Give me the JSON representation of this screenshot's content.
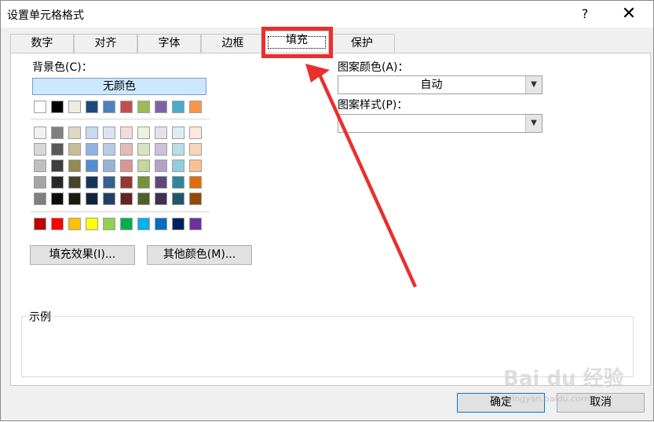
{
  "window": {
    "title": "设置单元格格式",
    "help": "?",
    "close": "✕"
  },
  "tabs": [
    {
      "label": "数字"
    },
    {
      "label": "对齐"
    },
    {
      "label": "字体"
    },
    {
      "label": "边框"
    },
    {
      "label": "填充",
      "active": true
    },
    {
      "label": "保护"
    }
  ],
  "fill": {
    "background_label": "背景色(C)：",
    "no_color": "无颜色",
    "theme_row": [
      "#ffffff",
      "#000000",
      "#eeece1",
      "#1f497d",
      "#4f81bd",
      "#c0504d",
      "#9bbb59",
      "#8064a2",
      "#4bacc6",
      "#f79646"
    ],
    "tint_rows": [
      [
        "#f2f2f2",
        "#7f7f7f",
        "#ddd9c3",
        "#c6d9f0",
        "#dbe5f1",
        "#f2dcdb",
        "#ebf1dd",
        "#e5e0ec",
        "#dbeef3",
        "#fdeada"
      ],
      [
        "#d8d8d8",
        "#595959",
        "#c4bd97",
        "#8db3e2",
        "#b8cce4",
        "#e5b9b7",
        "#d7e3bc",
        "#ccc1d9",
        "#b7dde8",
        "#fbd5b5"
      ],
      [
        "#bfbfbf",
        "#3f3f3f",
        "#938953",
        "#548dd4",
        "#95b3d7",
        "#d99694",
        "#c3d69b",
        "#b2a2c7",
        "#92cddc",
        "#fac08f"
      ],
      [
        "#a5a5a5",
        "#262626",
        "#494429",
        "#17365d",
        "#366092",
        "#953734",
        "#76923c",
        "#5f497a",
        "#31859b",
        "#e36c09"
      ],
      [
        "#7f7f7f",
        "#0c0c0c",
        "#1d1b10",
        "#0f243e",
        "#244061",
        "#632423",
        "#4f6128",
        "#3f3151",
        "#205867",
        "#974806"
      ]
    ],
    "standard_row": [
      "#c00000",
      "#ff0000",
      "#ffc000",
      "#ffff00",
      "#92d050",
      "#00b050",
      "#00b0f0",
      "#0070c0",
      "#002060",
      "#7030a0"
    ],
    "fill_effects_button": "填充效果(I)...",
    "more_colors_button": "其他颜色(M)...",
    "pattern_color_label": "图案颜色(A)：",
    "pattern_color_value": "自动",
    "pattern_style_label": "图案样式(P)：",
    "pattern_style_value": "",
    "sample_label": "示例"
  },
  "footer": {
    "ok": "确定",
    "cancel": "取消"
  },
  "watermark": {
    "text": "Bai du 经验",
    "sub": "jingyan.baidu.com"
  },
  "annotation": {
    "color": "#e8302e"
  }
}
